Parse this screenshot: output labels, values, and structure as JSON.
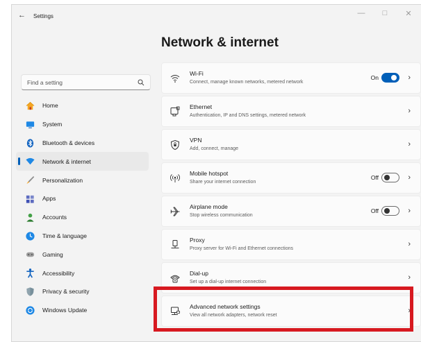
{
  "window": {
    "back_glyph": "←",
    "title": "Settings",
    "controls": {
      "minimize": "—",
      "maximize": "□",
      "close": "✕"
    }
  },
  "page_title": "Network & internet",
  "search": {
    "placeholder": "Find a setting",
    "value": ""
  },
  "nav": {
    "items": [
      {
        "label": "Home",
        "icon": "home-icon"
      },
      {
        "label": "System",
        "icon": "system-icon"
      },
      {
        "label": "Bluetooth & devices",
        "icon": "bluetooth-icon"
      },
      {
        "label": "Network & internet",
        "icon": "wifi-network-icon",
        "selected": true
      },
      {
        "label": "Personalization",
        "icon": "brush-icon"
      },
      {
        "label": "Apps",
        "icon": "apps-icon"
      },
      {
        "label": "Accounts",
        "icon": "person-icon"
      },
      {
        "label": "Time & language",
        "icon": "globe-clock-icon"
      },
      {
        "label": "Gaming",
        "icon": "gamepad-icon"
      },
      {
        "label": "Accessibility",
        "icon": "accessibility-icon"
      },
      {
        "label": "Privacy & security",
        "icon": "shield-icon"
      },
      {
        "label": "Windows Update",
        "icon": "update-icon"
      }
    ]
  },
  "settings": [
    {
      "title": "Wi-Fi",
      "subtitle": "Connect, manage known networks, metered network",
      "icon": "wifi-icon",
      "state": "On",
      "toggle": "on"
    },
    {
      "title": "Ethernet",
      "subtitle": "Authentication, IP and DNS settings, metered network",
      "icon": "ethernet-icon"
    },
    {
      "title": "VPN",
      "subtitle": "Add, connect, manage",
      "icon": "vpn-shield-icon"
    },
    {
      "title": "Mobile hotspot",
      "subtitle": "Share your internet connection",
      "icon": "hotspot-icon",
      "state": "Off",
      "toggle": "off"
    },
    {
      "title": "Airplane mode",
      "subtitle": "Stop wireless communication",
      "icon": "airplane-icon",
      "state": "Off",
      "toggle": "off"
    },
    {
      "title": "Proxy",
      "subtitle": "Proxy server for Wi-Fi and Ethernet connections",
      "icon": "proxy-icon"
    },
    {
      "title": "Dial-up",
      "subtitle": "Set up a dial-up internet connection",
      "icon": "dialup-icon"
    },
    {
      "title": "Advanced network settings",
      "subtitle": "View all network adapters, network reset",
      "icon": "advanced-network-icon",
      "highlighted": true
    }
  ],
  "chevron_glyph": "›",
  "colors": {
    "accent": "#005fb8",
    "highlight": "#d71920",
    "background": "#f3f3f3",
    "card": "#fbfbfb"
  }
}
